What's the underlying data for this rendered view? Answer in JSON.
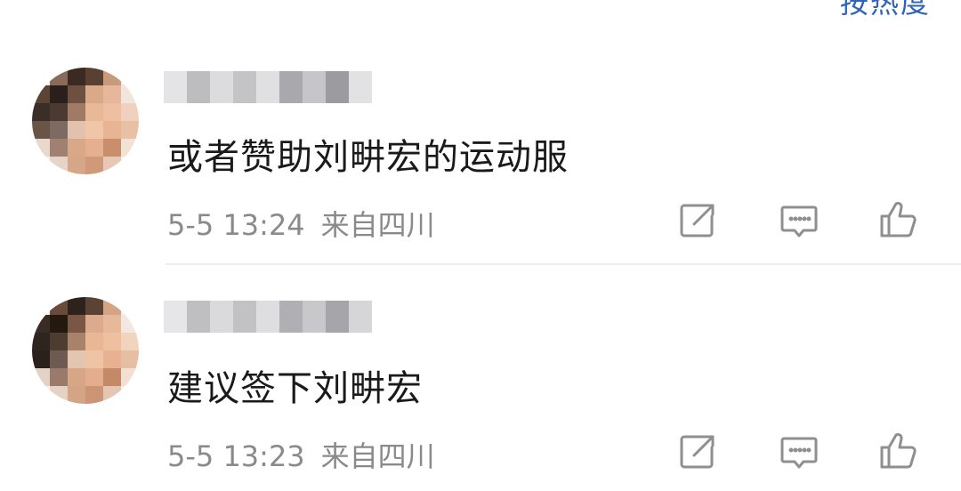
{
  "header": {
    "sort_label": "按热度"
  },
  "comments": [
    {
      "text": "或者赞助刘畊宏的运动服",
      "time": "5-5 13:24",
      "location": "来自四川",
      "actions": [
        "share-icon",
        "comment-icon",
        "like-icon"
      ]
    },
    {
      "text": "建议签下刘畊宏",
      "time": "5-5 13:23",
      "location": "来自四川",
      "actions": [
        "share-icon",
        "comment-icon",
        "like-icon"
      ]
    }
  ],
  "colors": {
    "text_primary": "#1a1a1a",
    "text_meta": "#8a8a8a",
    "accent_link": "#2f64b5",
    "icon_gray": "#8f8f8f",
    "divider": "#ececec"
  }
}
